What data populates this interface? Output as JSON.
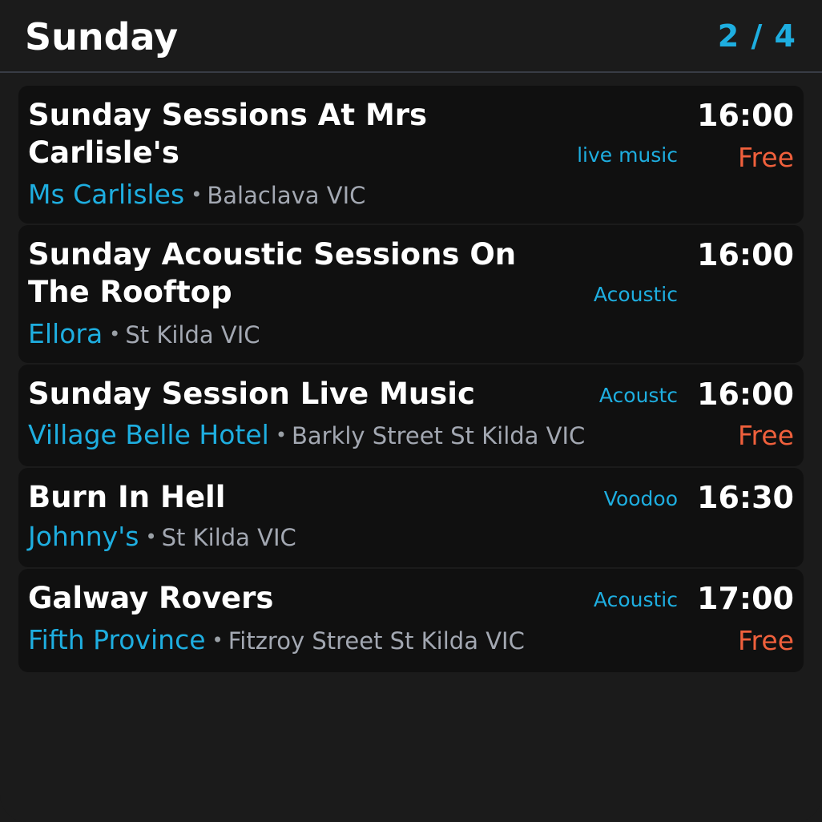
{
  "header": {
    "day": "Sunday",
    "page_indicator": "2 / 4"
  },
  "events": [
    {
      "title": "Sunday Sessions At Mrs Carlisle's",
      "genre": "live music",
      "time": "16:00",
      "price": "Free",
      "venue": "Ms Carlisles",
      "separator": "•",
      "location": "Balaclava VIC"
    },
    {
      "title": "Sunday Acoustic Sessions On The Rooftop",
      "genre": "Acoustic",
      "time": "16:00",
      "price": "",
      "venue": "Ellora",
      "separator": "•",
      "location": "St Kilda VIC"
    },
    {
      "title": "Sunday Session Live Music",
      "genre": "Acoustc",
      "time": "16:00",
      "price": "Free",
      "venue": "Village Belle Hotel",
      "separator": "•",
      "location": "Barkly Street St Kilda VIC"
    },
    {
      "title": "Burn In Hell",
      "genre": "Voodoo",
      "time": "16:30",
      "price": "",
      "venue": "Johnny's",
      "separator": "•",
      "location": "St Kilda VIC"
    },
    {
      "title": "Galway Rovers",
      "genre": "Acoustic",
      "time": "17:00",
      "price": "Free",
      "venue": "Fifth Province",
      "separator": "•",
      "location": "Fitzroy Street St Kilda VIC"
    }
  ],
  "colors": {
    "background": "#1b1b1b",
    "card": "#101010",
    "accent": "#1eaee0",
    "price": "#f0603c",
    "muted_text": "#a3a8b2"
  }
}
